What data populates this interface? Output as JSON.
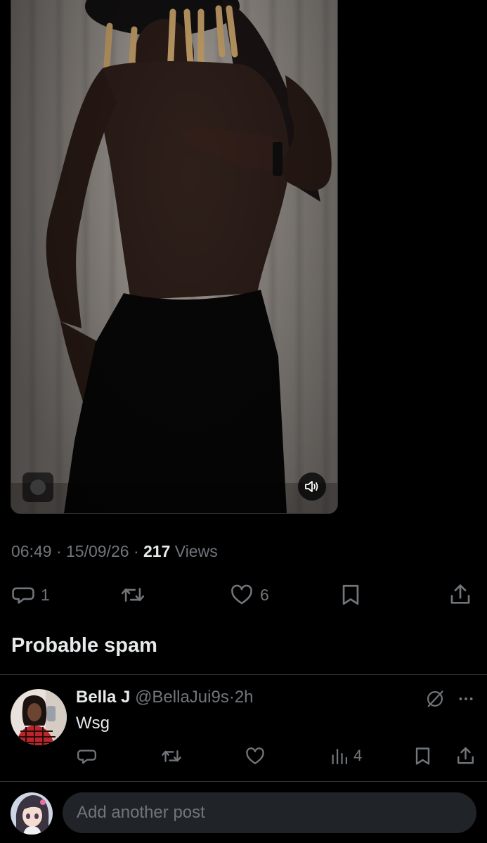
{
  "post": {
    "time": "06:49",
    "sep1": "·",
    "date": "15/09/26",
    "sep2": "·",
    "views_count": "217",
    "views_label": "Views"
  },
  "actions": {
    "replies": "1",
    "likes": "6"
  },
  "spam_section": {
    "title": "Probable spam"
  },
  "reply": {
    "name": "Bella J",
    "handle": "@BellaJui9s",
    "dot": "·",
    "time": "2h",
    "text": "Wsg",
    "views": "4"
  },
  "compose": {
    "placeholder": "Add another post"
  },
  "icons": {
    "video_sound": "speaker-sound-icon",
    "reply": "speech-bubble-icon",
    "retweet": "repost-icon",
    "like": "heart-icon",
    "bookmark": "bookmark-icon",
    "share": "share-icon",
    "analytics": "bar-chart-icon",
    "grok": "grok-icon",
    "more": "more-dots-icon"
  },
  "colors": {
    "background": "#000000",
    "text": "#e7e9ea",
    "secondary": "#71767b",
    "divider": "#2f3336",
    "compose_bg": "#202327"
  }
}
